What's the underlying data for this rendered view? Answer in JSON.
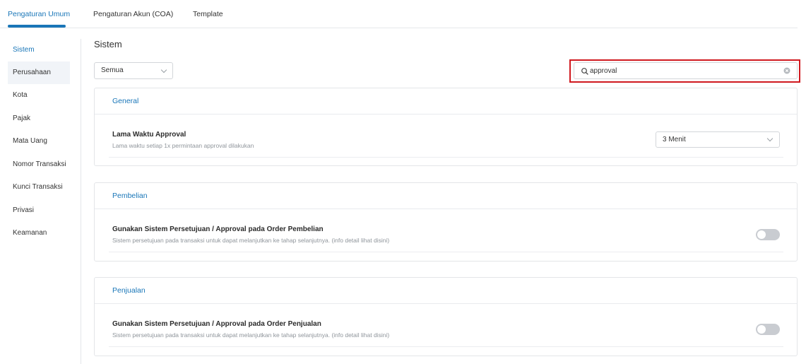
{
  "tabs": [
    {
      "label": "Pengaturan Umum",
      "active": true
    },
    {
      "label": "Pengaturan Akun (COA)",
      "active": false
    },
    {
      "label": "Template",
      "active": false
    }
  ],
  "sidebar": {
    "items": [
      {
        "label": "Sistem",
        "active": true
      },
      {
        "label": "Perusahaan",
        "active": false
      },
      {
        "label": "Kota",
        "active": false
      },
      {
        "label": "Pajak",
        "active": false
      },
      {
        "label": "Mata Uang",
        "active": false
      },
      {
        "label": "Nomor Transaksi",
        "active": false
      },
      {
        "label": "Kunci Transaksi",
        "active": false
      },
      {
        "label": "Privasi",
        "active": false
      },
      {
        "label": "Keamanan",
        "active": false
      }
    ]
  },
  "page": {
    "title": "Sistem"
  },
  "filter": {
    "value": "Semua"
  },
  "search": {
    "value": "approval",
    "icon": "search-icon",
    "clear_icon": "clear-icon"
  },
  "sections": [
    {
      "title": "General",
      "rows": [
        {
          "title": "Lama Waktu Approval",
          "description": "Lama waktu setiap 1x permintaan approval dilakukan",
          "control": "select",
          "value": "3 Menit"
        }
      ]
    },
    {
      "title": "Pembelian",
      "rows": [
        {
          "title": "Gunakan Sistem Persetujuan / Approval pada Order Pembelian",
          "description": "Sistem persetujuan pada transaksi untuk dapat melanjutkan ke tahap selanjutnya. (info detail lihat disini)",
          "control": "toggle",
          "enabled": false
        }
      ]
    },
    {
      "title": "Penjualan",
      "rows": [
        {
          "title": "Gunakan Sistem Persetujuan / Approval pada Order Penjualan",
          "description": "Sistem persetujuan pada transaksi untuk dapat melanjutkan ke tahap selanjutnya. (info detail lihat disini)",
          "control": "toggle",
          "enabled": false
        }
      ]
    }
  ],
  "colors": {
    "accent": "#1976b8",
    "highlight": "#d0191f",
    "toggle_off": "#c9ccd1"
  }
}
